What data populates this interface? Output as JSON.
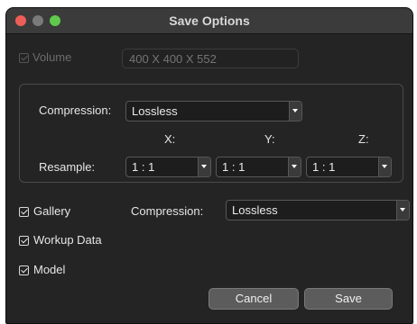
{
  "window": {
    "title": "Save Options",
    "traffic_lights": [
      "#ec5e57",
      "#7a7a7a",
      "#5fca4b"
    ]
  },
  "volume": {
    "label": "Volume",
    "checked": true,
    "enabled": false,
    "dimensions": "400 X 400 X 552"
  },
  "volume_settings": {
    "compression_label": "Compression:",
    "compression_value": "Lossless",
    "axis_labels": [
      "X:",
      "Y:",
      "Z:"
    ],
    "resample_label": "Resample:",
    "resample_values": [
      "1 : 1",
      "1 : 1",
      "1 : 1"
    ]
  },
  "gallery": {
    "label": "Gallery",
    "checked": true,
    "compression_label": "Compression:",
    "compression_value": "Lossless"
  },
  "workup_data": {
    "label": "Workup Data",
    "checked": true
  },
  "model": {
    "label": "Model",
    "checked": true
  },
  "buttons": {
    "cancel": "Cancel",
    "save": "Save"
  },
  "colors": {
    "window_bg": "#242424",
    "titlebar_bg": "#3b3b3b",
    "button_bg": "#5c5c5c"
  }
}
